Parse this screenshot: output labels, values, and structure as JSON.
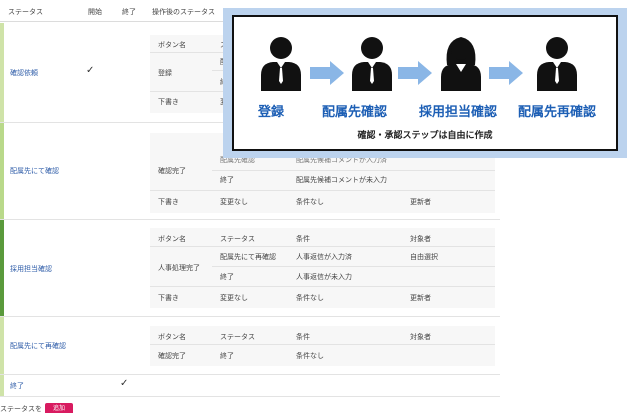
{
  "header": {
    "status": "ステータス",
    "start": "開始",
    "end": "終了",
    "after_status": "操作後のステータス"
  },
  "inner_header": {
    "button_name": "ボタン名",
    "status": "ステータス",
    "condition": "条件",
    "target": "対象者"
  },
  "steps": [
    {
      "label": "確認依頼",
      "start_check": "✓",
      "rows": {
        "b1": "登録",
        "b1_s1": "配",
        "b1_s2": "終",
        "draft": "下書き",
        "draft_s": "変"
      }
    },
    {
      "label": "配属先にて確認",
      "rows": {
        "partial_status": "配属先確認",
        "partial_cond": "配属先候補コメントが入力済",
        "b1": "確認完了",
        "b1_s2": "終了",
        "b1_c2": "配属先候補コメントが未入力",
        "draft": "下書き",
        "draft_s": "変更なし",
        "draft_c": "条件なし",
        "draft_t": "更新者"
      }
    },
    {
      "label": "採用担当確認",
      "rows": {
        "b1": "人事処理完了",
        "b1_s1": "配属先にて再確認",
        "b1_c1": "人事返信が入力済",
        "b1_t1": "自由選択",
        "b1_s2": "終了",
        "b1_c2": "人事返信が未入力",
        "draft": "下書き",
        "draft_s": "変更なし",
        "draft_c": "条件なし",
        "draft_t": "更新者"
      }
    },
    {
      "label": "配属先にて再確認",
      "rows": {
        "b1": "確認完了",
        "b1_s1": "終了",
        "b1_c1": "条件なし"
      }
    },
    {
      "label": "終了",
      "end_check": "✓"
    }
  ],
  "bottom": {
    "label": "ステータスを",
    "button": "追加"
  },
  "overlay": {
    "people": [
      {
        "name": "登録",
        "gender": "male"
      },
      {
        "name": "配属先確認",
        "gender": "male"
      },
      {
        "name": "採用担当確認",
        "gender": "female"
      },
      {
        "name": "配属先再確認",
        "gender": "male"
      }
    ],
    "caption": "確認・承認ステップは自由に作成"
  },
  "colors": {
    "bar_1": "#cfe3a8",
    "bar_2": "#b9d98a",
    "bar_3": "#5a9a3c",
    "bar_4": "#cfe3a8",
    "bar_5": "#cfe3a8",
    "link": "#2e5ca8",
    "accent_button": "#d81b60",
    "overlay_bg": "#bcd3ee",
    "arrow": "#8ab6e6",
    "label_blue": "#1d5fb5"
  }
}
